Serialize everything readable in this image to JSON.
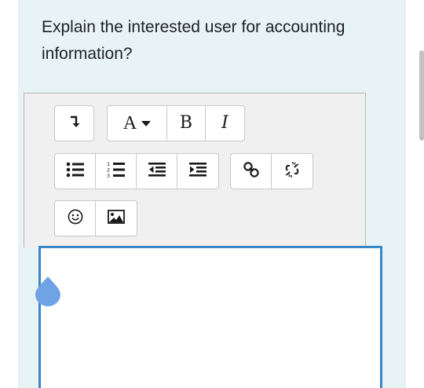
{
  "question": {
    "text": "Explain the interested user for accounting information?"
  },
  "toolbar": {
    "row1": [
      {
        "name": "show-more-buttons-button",
        "icon": "arrow-down-icon"
      },
      {
        "name": "paragraph-styles-button",
        "label": "A"
      },
      {
        "name": "bold-button",
        "label": "B"
      },
      {
        "name": "italic-button",
        "label": "I"
      }
    ],
    "row2": [
      {
        "name": "unordered-list-button",
        "icon": "bullet-list-icon"
      },
      {
        "name": "ordered-list-button",
        "icon": "numbered-list-icon"
      },
      {
        "name": "outdent-button",
        "icon": "outdent-icon"
      },
      {
        "name": "indent-button",
        "icon": "indent-icon"
      },
      {
        "name": "link-button",
        "icon": "link-icon"
      },
      {
        "name": "unlink-button",
        "icon": "unlink-icon"
      }
    ],
    "row3": [
      {
        "name": "emoticon-button",
        "icon": "smiley-icon"
      },
      {
        "name": "image-button",
        "icon": "image-icon"
      }
    ]
  },
  "editor": {
    "content": ""
  },
  "colors": {
    "panel_bg": "#e7f3f5",
    "toolbar_bg": "#f0f0f0",
    "editor_border": "#3b87c8",
    "handle": "#6fa3e6"
  }
}
